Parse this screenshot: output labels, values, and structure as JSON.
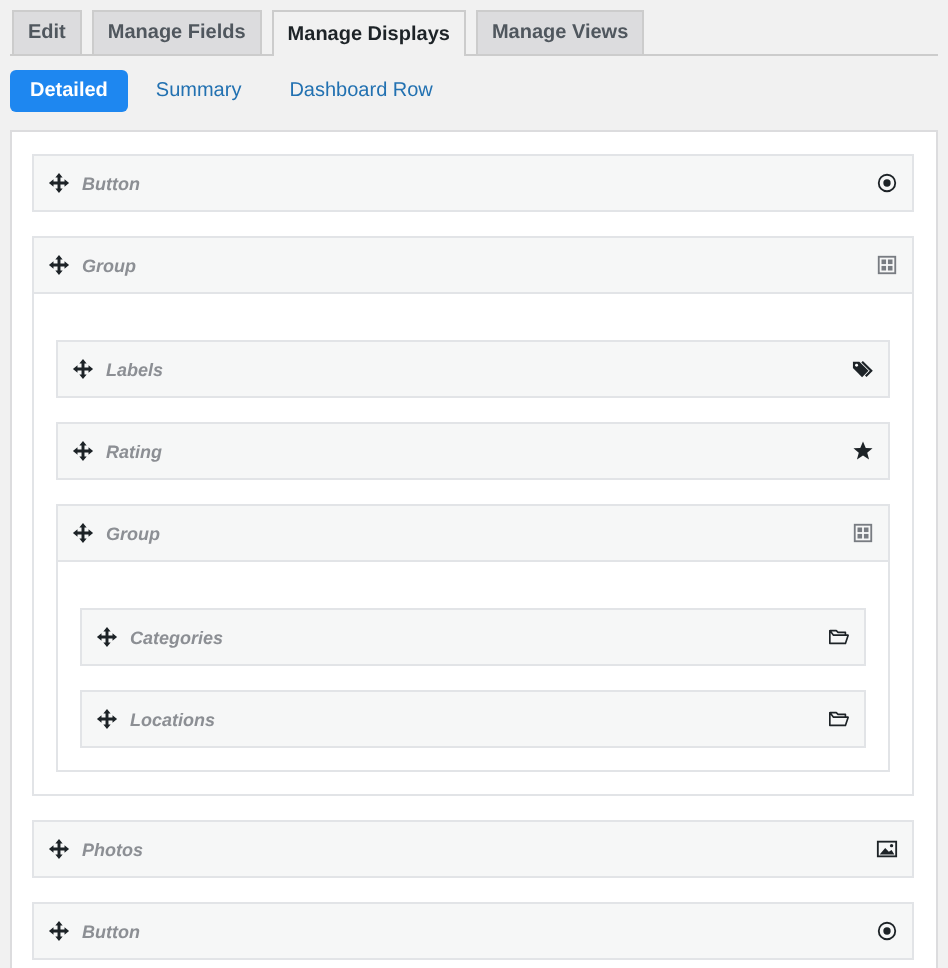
{
  "tabs": [
    {
      "label": "Edit",
      "selected": false
    },
    {
      "label": "Manage Fields",
      "selected": false
    },
    {
      "label": "Manage Displays",
      "selected": true
    },
    {
      "label": "Manage Views",
      "selected": false
    }
  ],
  "subtabs": [
    {
      "label": "Detailed",
      "selected": true
    },
    {
      "label": "Summary",
      "selected": false
    },
    {
      "label": "Dashboard Row",
      "selected": false
    }
  ],
  "items": [
    {
      "kind": "button",
      "label": "Button"
    },
    {
      "kind": "group",
      "label": "Group",
      "children": [
        {
          "kind": "labels",
          "label": "Labels"
        },
        {
          "kind": "rating",
          "label": "Rating"
        },
        {
          "kind": "group",
          "label": "Group",
          "children": [
            {
              "kind": "taxonomy",
              "label": "Categories"
            },
            {
              "kind": "taxonomy",
              "label": "Locations"
            }
          ]
        }
      ]
    },
    {
      "kind": "photos",
      "label": "Photos"
    },
    {
      "kind": "button",
      "label": "Button"
    }
  ]
}
